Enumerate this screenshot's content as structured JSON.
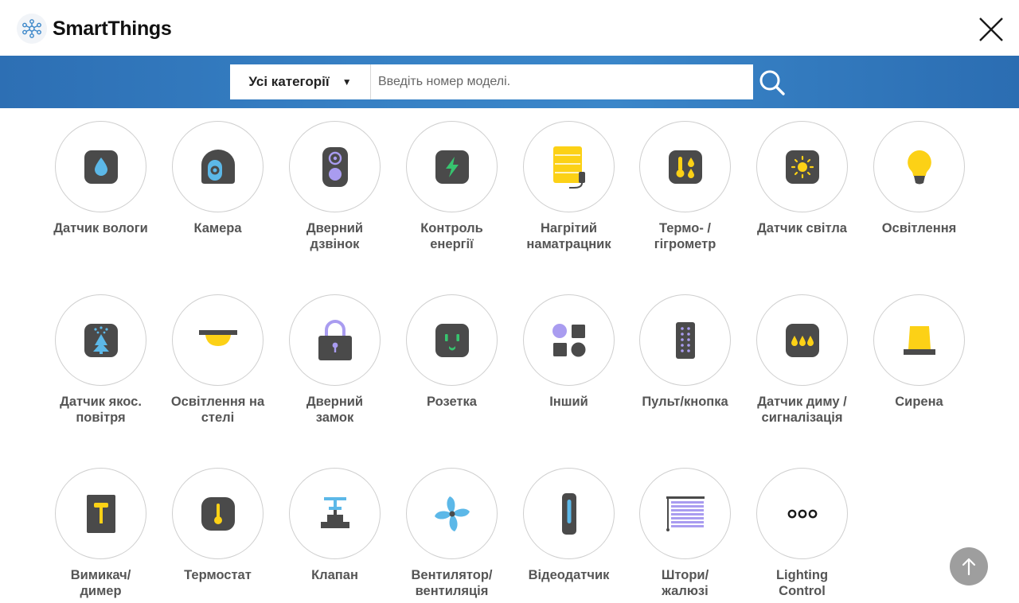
{
  "app": {
    "brand": "SmartThings"
  },
  "search": {
    "category_label": "Усі категорії",
    "category_arrow": "▼",
    "placeholder": "Введіть номер моделі."
  },
  "categories": [
    {
      "label": "Датчик вологи",
      "icon": "water-leak-sensor-icon"
    },
    {
      "label": "Камера",
      "icon": "camera-icon"
    },
    {
      "label": "Дверний\nдзвінок",
      "icon": "doorbell-icon"
    },
    {
      "label": "Контроль\nенергії",
      "icon": "energy-monitor-icon"
    },
    {
      "label": "Нагрітий\nнаматрацник",
      "icon": "heated-mattress-pad-icon"
    },
    {
      "label": "Термо- /\nгігрометр",
      "icon": "thermo-hygrometer-icon"
    },
    {
      "label": "Датчик світла",
      "icon": "light-sensor-icon"
    },
    {
      "label": "Освітлення",
      "icon": "light-bulb-icon"
    },
    {
      "label": "Датчик якос.\nповітря",
      "icon": "air-quality-sensor-icon"
    },
    {
      "label": "Освітлення на\nстелі",
      "icon": "ceiling-light-icon"
    },
    {
      "label": "Дверний\nзамок",
      "icon": "door-lock-icon"
    },
    {
      "label": "Розетка",
      "icon": "smart-plug-icon"
    },
    {
      "label": "Інший",
      "icon": "other-shapes-icon"
    },
    {
      "label": "Пульт/кнопка",
      "icon": "remote-control-icon"
    },
    {
      "label": "Датчик диму /\nсигналізація",
      "icon": "smoke-detector-icon"
    },
    {
      "label": "Сирена",
      "icon": "siren-icon"
    },
    {
      "label": "Вимикач/\nдимер",
      "icon": "switch-dimmer-icon"
    },
    {
      "label": "Термостат",
      "icon": "thermostat-icon"
    },
    {
      "label": "Клапан",
      "icon": "valve-icon"
    },
    {
      "label": "Вентилятор/\nвентиляція",
      "icon": "fan-icon"
    },
    {
      "label": "Відеодатчик",
      "icon": "video-sensor-icon"
    },
    {
      "label": "Штори/\nжалюзі",
      "icon": "blinds-icon"
    },
    {
      "label": "Lighting\nControl",
      "icon": "more-dots-icon"
    }
  ],
  "colors": {
    "band": "#3680c4",
    "icon_dark": "#4a4a4a",
    "accent_yellow": "#fcd116",
    "accent_blue": "#5cb8e8",
    "accent_purple": "#a99cf0",
    "accent_green": "#37c46f"
  }
}
